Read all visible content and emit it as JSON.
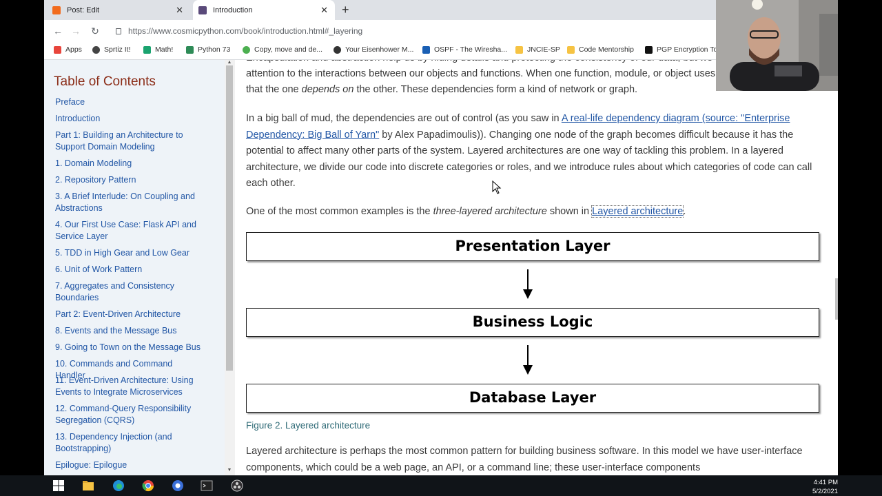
{
  "browser": {
    "tabs": [
      {
        "title": "Post: Edit",
        "favicon_color": "#f26b1d"
      },
      {
        "title": "Introduction",
        "favicon_color": "#5a4a7a"
      }
    ],
    "new_tab": "+",
    "url": "https://www.cosmicpython.com/book/introduction.html#_layering",
    "bookmarks": [
      {
        "label": "Apps",
        "icon_color": "#e8453c"
      },
      {
        "label": "Sprtiz It!",
        "icon_color": "#444"
      },
      {
        "label": "Math!",
        "icon_color": "#1aa36f"
      },
      {
        "label": "Python 73",
        "icon_color": "#2e8b57"
      },
      {
        "label": "Copy, move and de...",
        "icon_color": "#4caf50"
      },
      {
        "label": "Your Eisenhower M...",
        "icon_color": "#333"
      },
      {
        "label": "OSPF - The Wiresha...",
        "icon_color": "#1a5fb4"
      },
      {
        "label": "JNCIE-SP",
        "icon_color": "#f6c343"
      },
      {
        "label": "Code Mentorship",
        "icon_color": "#f6c343"
      },
      {
        "label": "PGP Encryption To",
        "icon_color": "#111"
      }
    ]
  },
  "toc": {
    "title": "Table of Contents",
    "items": [
      "Preface",
      "Introduction",
      "Part 1: Building an Architecture to Support Domain Modeling",
      "1. Domain Modeling",
      "2. Repository Pattern",
      "3. A Brief Interlude: On Coupling and Abstractions",
      "4. Our First Use Case: Flask API and Service Layer",
      "5. TDD in High Gear and Low Gear",
      "6. Unit of Work Pattern",
      "7. Aggregates and Consistency Boundaries",
      "Part 2: Event-Driven Architecture",
      "8. Events and the Message Bus",
      "9. Going to Town on the Message Bus",
      "10. Commands and Command Handler",
      "11. Event-Driven Architecture: Using Events to Integrate Microservices",
      "12. Command-Query Responsibility Segregation (CQRS)",
      "13. Dependency Injection (and Bootstrapping)",
      "Epilogue: Epilogue"
    ]
  },
  "content": {
    "p0_line1": "Encapsulation and abstraction help us by hiding details and protecting the consistency of our data, but we also need to pay",
    "p0_line2": "attention to the interactions between our objects and functions. When one function, module, or object uses another, we say",
    "p0_line3_a": "that the one ",
    "p0_line3_em": "depends on",
    "p0_line3_b": " the other. These dependencies form a kind of network or graph.",
    "p1_a": "In a big ball of mud, the dependencies are out of control (as you saw in ",
    "p1_link": "A real-life dependency diagram (source: \"Enterprise Dependency: Big Ball of Yarn\"",
    "p1_b": " by Alex Papadimoulis)). Changing one node of the graph becomes difficult because it has the potential to affect many other parts of the system. Layered architectures are one way of tackling this problem. In a layered architecture, we divide our code into discrete categories or roles, and we introduce rules about which categories of code can call each other.",
    "p2_a": "One of the most common examples is the ",
    "p2_em": "three-layered architecture",
    "p2_b": " shown in ",
    "p2_link": "Layered architecture",
    "p2_c": ".",
    "layers": [
      "Presentation Layer",
      "Business Logic",
      "Database Layer"
    ],
    "caption": "Figure 2. Layered architecture",
    "p3": "Layered architecture is perhaps the most common pattern for building business software. In this model we have user-interface components, which could be a web page, an API, or a command line; these user-interface components"
  },
  "taskbar": {
    "time": "4:41 PM",
    "date": "5/2/2021"
  }
}
